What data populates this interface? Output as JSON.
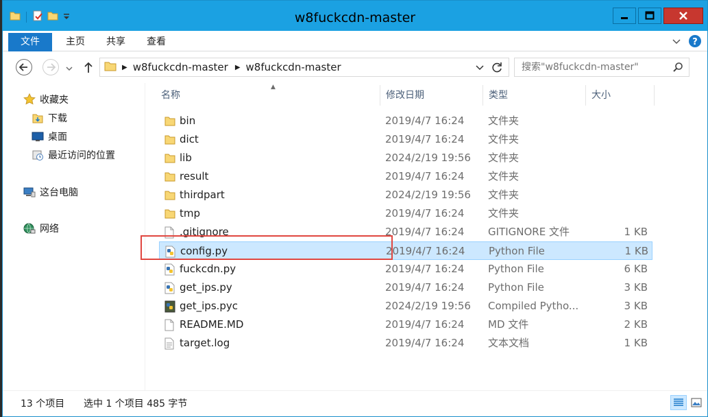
{
  "window": {
    "title": "w8fuckcdn-master"
  },
  "ribbon": {
    "tabs": [
      {
        "label": "文件"
      },
      {
        "label": "主页"
      },
      {
        "label": "共享"
      },
      {
        "label": "查看"
      }
    ]
  },
  "address": {
    "crumbs": [
      "w8fuckcdn-master",
      "w8fuckcdn-master"
    ]
  },
  "search": {
    "placeholder": "搜索\"w8fuckcdn-master\""
  },
  "navpane": {
    "favorites": "收藏夹",
    "downloads": "下载",
    "desktop": "桌面",
    "recent": "最近访问的位置",
    "computer": "这台电脑",
    "network": "网络"
  },
  "columns": {
    "name": "名称",
    "date": "修改日期",
    "type": "类型",
    "size": "大小"
  },
  "files": [
    {
      "name": "bin",
      "date": "2019/4/7 16:24",
      "type": "文件夹",
      "size": "",
      "icon": "folder"
    },
    {
      "name": "dict",
      "date": "2019/4/7 16:24",
      "type": "文件夹",
      "size": "",
      "icon": "folder"
    },
    {
      "name": "lib",
      "date": "2024/2/19 19:56",
      "type": "文件夹",
      "size": "",
      "icon": "folder"
    },
    {
      "name": "result",
      "date": "2019/4/7 16:24",
      "type": "文件夹",
      "size": "",
      "icon": "folder"
    },
    {
      "name": "thirdpart",
      "date": "2024/2/19 19:56",
      "type": "文件夹",
      "size": "",
      "icon": "folder"
    },
    {
      "name": "tmp",
      "date": "2019/4/7 16:24",
      "type": "文件夹",
      "size": "",
      "icon": "folder"
    },
    {
      "name": ".gitignore",
      "date": "2019/4/7 16:24",
      "type": "GITIGNORE 文件",
      "size": "1 KB",
      "icon": "file"
    },
    {
      "name": "config.py",
      "date": "2019/4/7 16:24",
      "type": "Python File",
      "size": "1 KB",
      "icon": "python",
      "selected": true
    },
    {
      "name": "fuckcdn.py",
      "date": "2019/4/7 16:24",
      "type": "Python File",
      "size": "6 KB",
      "icon": "python"
    },
    {
      "name": "get_ips.py",
      "date": "2019/4/7 16:24",
      "type": "Python File",
      "size": "3 KB",
      "icon": "python"
    },
    {
      "name": "get_ips.pyc",
      "date": "2024/2/19 19:56",
      "type": "Compiled Pytho...",
      "size": "3 KB",
      "icon": "pyc"
    },
    {
      "name": "README.MD",
      "date": "2019/4/7 16:24",
      "type": "MD 文件",
      "size": "2 KB",
      "icon": "file"
    },
    {
      "name": "target.log",
      "date": "2019/4/7 16:24",
      "type": "文本文档",
      "size": "1 KB",
      "icon": "text"
    }
  ],
  "status": {
    "count": "13 个项目",
    "selection": "选中 1 个项目  485 字节"
  },
  "colors": {
    "titlebar": "#1ba1e2",
    "file_tab": "#1979ca",
    "selection": "#cce8ff",
    "highlight_box": "#e0463f"
  }
}
